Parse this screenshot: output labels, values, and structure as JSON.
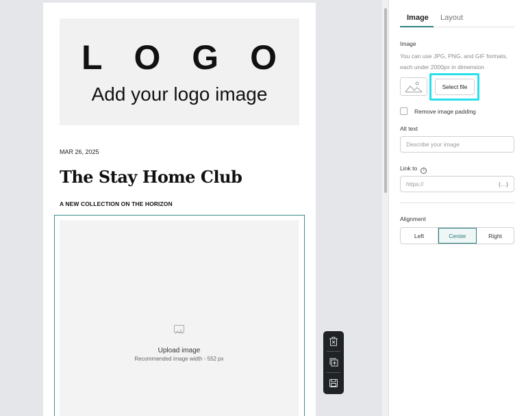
{
  "canvas": {
    "logo": {
      "letters": [
        "L",
        "O",
        "G",
        "O"
      ],
      "subtitle": "Add your logo image"
    },
    "date": "MAR 26, 2025",
    "title": "The Stay Home Club",
    "subtitle": "A NEW COLLECTION ON THE HORIZON",
    "image_block": {
      "upload_label": "Upload image",
      "upload_hint": "Recommended image width - 552 px"
    }
  },
  "floating_toolbar": {
    "icons": [
      "delete-icon",
      "duplicate-icon",
      "save-icon"
    ]
  },
  "panel": {
    "tabs": [
      {
        "label": "Image",
        "active": true
      },
      {
        "label": "Layout",
        "active": false
      }
    ],
    "image_section": {
      "label": "Image",
      "helper": "You can use JPG, PNG, and GIF formats, each under 2000px in dimension",
      "select_file": "Select file"
    },
    "remove_padding": {
      "label": "Remove image padding",
      "checked": false
    },
    "alt_text": {
      "label": "Alt text",
      "placeholder": "Describe your image"
    },
    "link_to": {
      "label": "Link to",
      "info_icon": "info-icon",
      "placeholder": "https://",
      "var_icon": "{…}"
    },
    "alignment": {
      "label": "Alignment",
      "options": [
        "Left",
        "Center",
        "Right"
      ],
      "selected": "Center"
    }
  },
  "colors": {
    "accent": "#2c7d7a",
    "highlight": "#25e0eb",
    "toolbar_bg": "#1f2326"
  }
}
